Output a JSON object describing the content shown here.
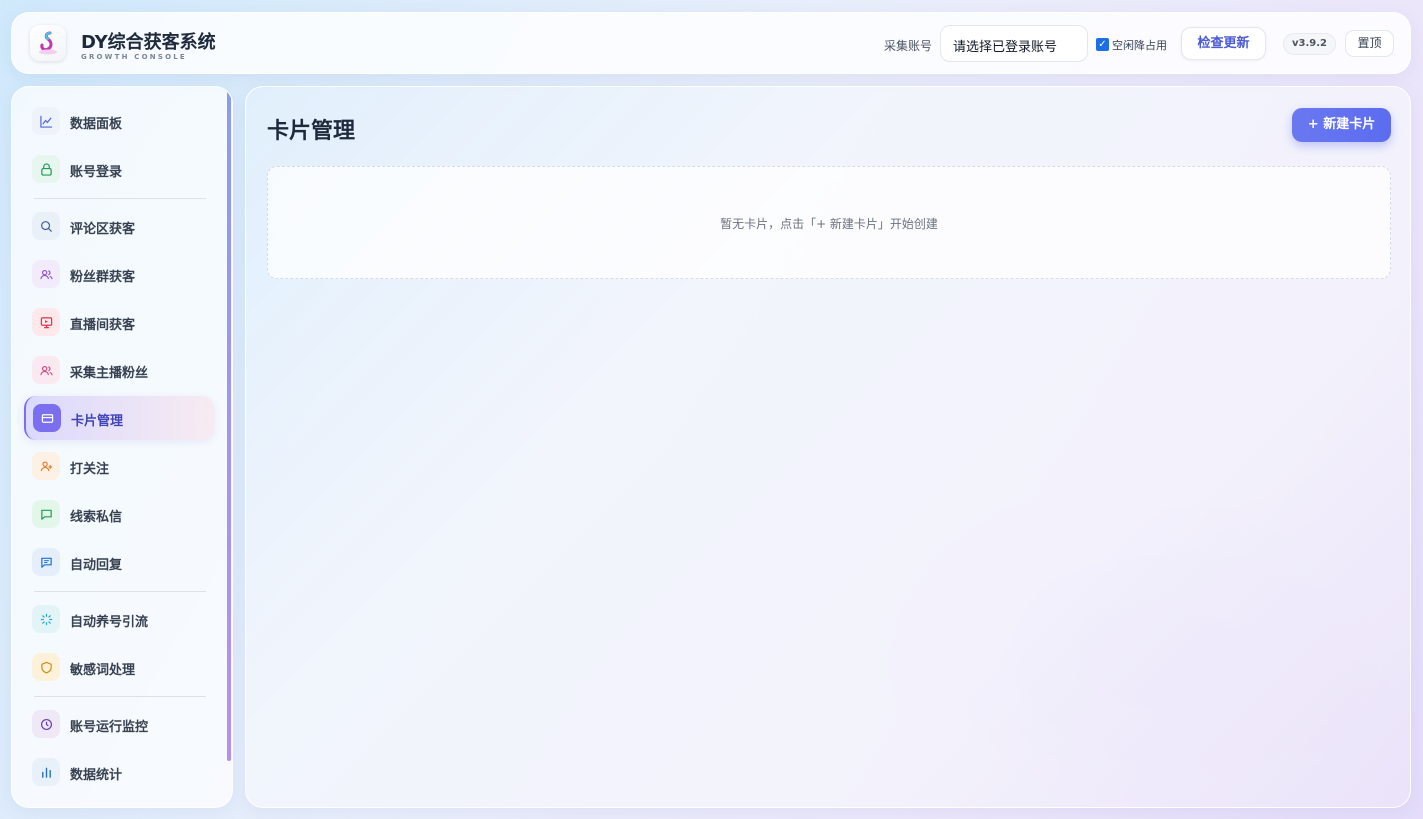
{
  "header": {
    "app_title": "DY综合获客系统",
    "app_subtitle": "GROWTH CONSOLE",
    "collect_label": "采集账号",
    "account_placeholder": "请选择已登录账号",
    "idle_checked": true,
    "idle_label": "空闲降占用",
    "update_label": "检查更新",
    "version": "v3.9.2",
    "top_label": "置顶"
  },
  "sidebar": {
    "items": [
      {
        "label": "数据面板",
        "icon": "line-chart-icon",
        "color": "#4f6ad8",
        "bg": "#eef2fb"
      },
      {
        "label": "账号登录",
        "icon": "lock-icon",
        "color": "#1f9d57",
        "bg": "#e7f6ee"
      },
      {
        "label": "评论区获客",
        "icon": "search-icon",
        "color": "#3f5f9a",
        "bg": "#eaf0f8"
      },
      {
        "label": "粉丝群获客",
        "icon": "users-icon",
        "color": "#8a4fcf",
        "bg": "#f2ebfb"
      },
      {
        "label": "直播间获客",
        "icon": "live-monitor-icon",
        "color": "#e0324a",
        "bg": "#fde8ec"
      },
      {
        "label": "采集主播粉丝",
        "icon": "users-icon",
        "color": "#d2457f",
        "bg": "#fbe9f1"
      },
      {
        "label": "卡片管理",
        "icon": "card-icon",
        "color": "#ffffff",
        "bg": "#7b6ff0"
      },
      {
        "label": "打关注",
        "icon": "user-plus-icon",
        "color": "#e6772a",
        "bg": "#fdf0e4"
      },
      {
        "label": "线索私信",
        "icon": "message-icon",
        "color": "#1f9d57",
        "bg": "#e3f6ea"
      },
      {
        "label": "自动回复",
        "icon": "chat-reply-icon",
        "color": "#1f6fd6",
        "bg": "#e5effb"
      },
      {
        "label": "自动养号引流",
        "icon": "loader-icon",
        "color": "#2aa6c9",
        "bg": "#e3f4f9"
      },
      {
        "label": "敏感词处理",
        "icon": "shield-icon",
        "color": "#d58a10",
        "bg": "#fdf2d9"
      },
      {
        "label": "账号运行监控",
        "icon": "clock-icon",
        "color": "#6a3fb3",
        "bg": "#eee8f7"
      },
      {
        "label": "数据统计",
        "icon": "bar-chart-icon",
        "color": "#2b6fb8",
        "bg": "#e8f1fa"
      }
    ],
    "active_index": 6
  },
  "main": {
    "title": "卡片管理",
    "new_button": "+ 新建卡片",
    "empty_text": "暂无卡片，点击「+ 新建卡片」开始创建"
  }
}
